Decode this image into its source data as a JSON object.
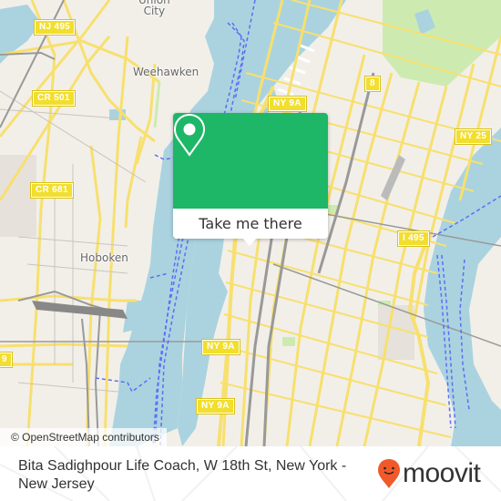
{
  "map": {
    "places": [
      {
        "name": "Union City",
        "label": "Union\nCity"
      },
      {
        "name": "Weehawken",
        "label": "Weehawken"
      },
      {
        "name": "Hoboken",
        "label": "Hoboken"
      }
    ],
    "shields": [
      {
        "id": "nj495",
        "label": "NJ 495"
      },
      {
        "id": "cr501",
        "label": "CR 501"
      },
      {
        "id": "cr681",
        "label": "CR 681"
      },
      {
        "id": "ny9a_top",
        "label": "NY 9A"
      },
      {
        "id": "route8",
        "label": "8"
      },
      {
        "id": "ny25",
        "label": "NY 25"
      },
      {
        "id": "i495",
        "label": "I 495"
      },
      {
        "id": "ny9a_mid",
        "label": "NY 9A"
      },
      {
        "id": "ny9a_low",
        "label": "NY 9A"
      },
      {
        "id": "ny9a_left",
        "label": "9"
      }
    ],
    "attribution": "© OpenStreetMap contributors",
    "colors": {
      "water": "#aad3df",
      "land": "#f2efe9",
      "road": "#f7e06e",
      "park": "#cdebb0",
      "ferry": "#5b6ef5"
    }
  },
  "popup": {
    "pin_icon": "map-pin-icon",
    "action_label": "Take me there",
    "accent_color": "#1db767"
  },
  "footer": {
    "title": "Bita Sadighpour Life Coach, W 18th St, New York - New Jersey",
    "brand": "moovit",
    "brand_color": "#f0592a"
  }
}
